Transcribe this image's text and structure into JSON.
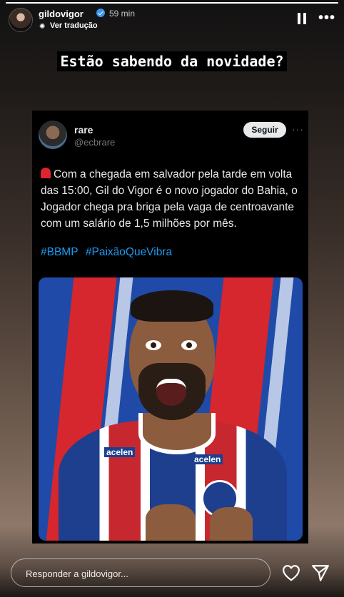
{
  "story": {
    "progress": 1.0
  },
  "header": {
    "username": "gildovigor",
    "time": "59 min",
    "translate_label": "Ver tradução",
    "more_label": "•••"
  },
  "headline": "Estão sabendo da novidade?",
  "tweet": {
    "name": "rare",
    "handle": "@ecbrare",
    "follow_label": "Seguir",
    "more_label": "···",
    "text": "Com a chegada em salvador pela tarde em volta das 15:00, Gil do Vigor é o novo jogador do Bahia, o Jogador chega pra briga pela vaga de centroavante com um salário de 1,5 milhões por mês.",
    "hashtags": [
      "#BBMP",
      "#PaixãoQueVibra"
    ],
    "media": {
      "sponsor_left": "acelen",
      "sponsor_right": "acelen"
    }
  },
  "footer": {
    "reply_placeholder": "Responder a gildovigor..."
  },
  "colors": {
    "link": "#1d9bf0",
    "verified": "#3897f0",
    "bahia_blue": "#1d3f8e",
    "bahia_red": "#d6262e"
  }
}
